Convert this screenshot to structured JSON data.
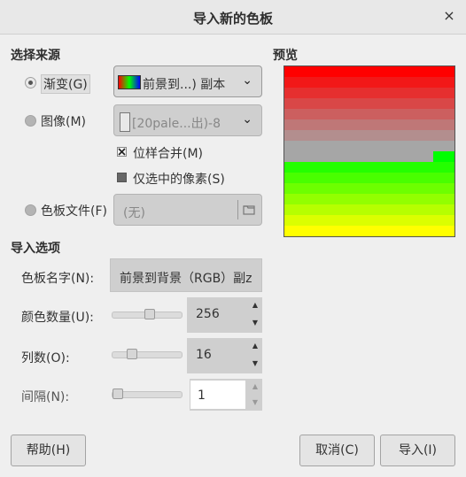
{
  "window": {
    "title": "导入新的色板",
    "close_label": "×"
  },
  "source": {
    "heading": "选择来源",
    "gradient": {
      "label": "渐变(G)",
      "selected": true,
      "value": "前景到...)  副本"
    },
    "image": {
      "label": "图像(M)",
      "selected": false,
      "value": "[20pale...出)-8"
    },
    "sample_merged": {
      "label": "位样合并(M)",
      "checked": true
    },
    "selected_only": {
      "label": "仅选中的像素(S)",
      "checked": false
    },
    "palette_file": {
      "label": "色板文件(F)",
      "selected": false,
      "value": "(无)"
    }
  },
  "preview": {
    "heading": "预览"
  },
  "options": {
    "heading": "导入选项",
    "palette_name": {
      "label": "色板名字(N):",
      "value": "前景到背景（RGB）副z"
    },
    "num_colors": {
      "label": "颜色数量(U):",
      "value": "256"
    },
    "columns": {
      "label": "列数(O):",
      "value": "16"
    },
    "interval": {
      "label": "间隔(N):",
      "value": "1"
    }
  },
  "buttons": {
    "help": "帮助(H)",
    "cancel": "取消(C)",
    "import": "导入(I)"
  },
  "colors": {
    "gradient_start": "#ff0000",
    "gradient_end": "#ffff00",
    "preview_mid": "#a6a6a6"
  }
}
